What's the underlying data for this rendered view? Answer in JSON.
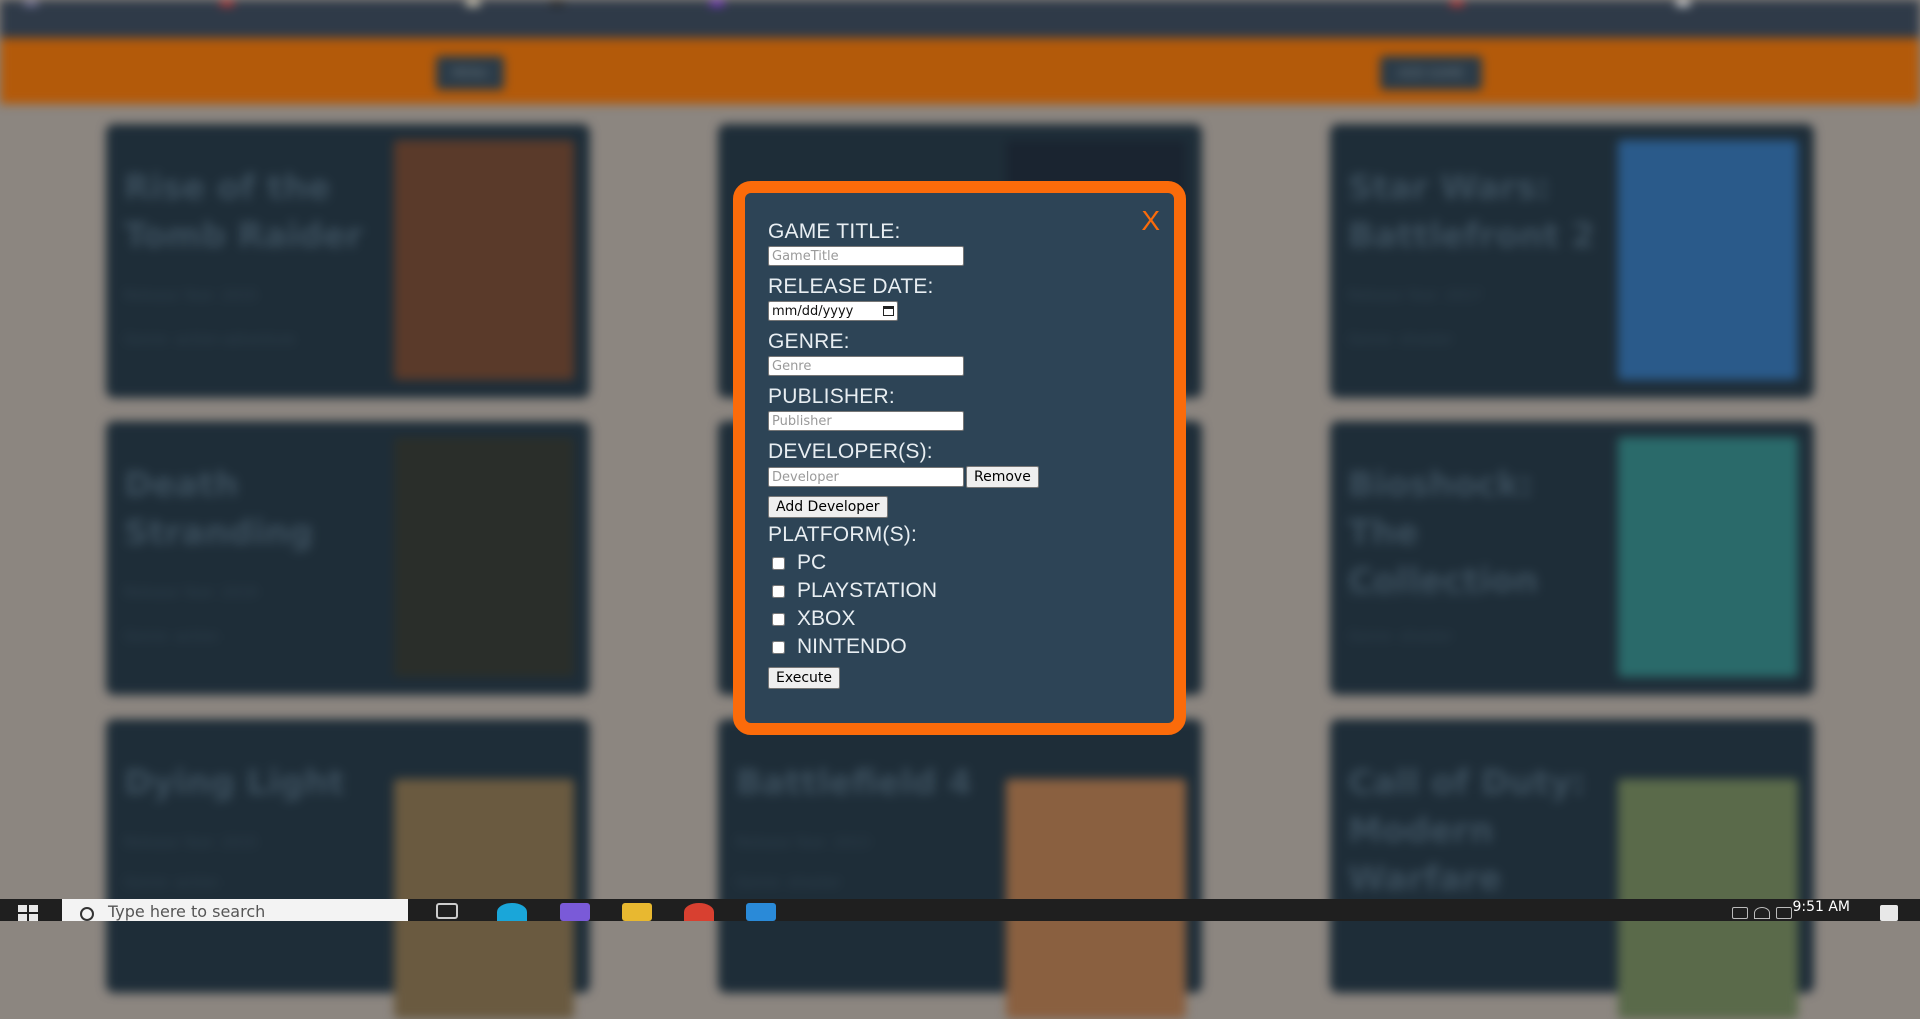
{
  "header": {
    "left_button": "MENU",
    "right_button": "ADD GAME"
  },
  "cards": [
    {
      "title": "Rise of the Tomb Raider",
      "release": "Release Year: 2015",
      "genre": "Genre: action-adventure",
      "cover_color": "#5a3a2a"
    },
    {
      "title": "",
      "release": "",
      "genre": "",
      "cover_color": "#1a2430"
    },
    {
      "title": "Star Wars: Battlefront 2",
      "release": "Release Year: 2017",
      "genre": "Genre: shooter",
      "cover_color": "#2a5a8a"
    },
    {
      "title": "Death Stranding",
      "release": "Release Year: 2019",
      "genre": "Genre: action",
      "cover_color": "#2a2e2a"
    },
    {
      "title": "",
      "release": "",
      "genre": "",
      "cover_color": "#1e2d38"
    },
    {
      "title": "Bioshock: The Collection",
      "release": "Release Year: 2016",
      "genre": "Genre: shooter",
      "cover_color": "#2a6a6a"
    },
    {
      "title": "Dying Light",
      "release": "Release Year: 2015",
      "genre": "Genre: action",
      "cover_color": "#6a5a40"
    },
    {
      "title": "Battlefield 4",
      "release": "Release Year: 2013",
      "genre": "Genre: shooter",
      "cover_color": "#8a6040"
    },
    {
      "title": "Call of Duty: Modern Warfare",
      "release": "Release Year: 2019",
      "genre": "Genre: shooter",
      "cover_color": "#5a6a4a"
    }
  ],
  "modal": {
    "close_label": "X",
    "game_title_label": "GAME TITLE:",
    "game_title_placeholder": "GameTitle",
    "release_date_label": "RELEASE DATE:",
    "release_date_value": "mm/dd/yyyy",
    "genre_label": "GENRE:",
    "genre_placeholder": "Genre",
    "publisher_label": "PUBLISHER:",
    "publisher_placeholder": "Publisher",
    "developers_label": "DEVELOPER(S):",
    "developer_placeholder": "Developer",
    "remove_button": "Remove",
    "add_developer_button": "Add Developer",
    "platforms_label": "PLATFORM(S):",
    "platforms": [
      "PC",
      "PLAYSTATION",
      "XBOX",
      "NINTENDO"
    ],
    "execute_button": "Execute"
  },
  "taskbar": {
    "search_placeholder": "Type here to search",
    "clock": "9:51 AM"
  },
  "colors": {
    "accent": "#fb6b0a",
    "modal_bg": "#2d4456",
    "card_bg": "#1e2d38",
    "header_bg": "#b35a0a"
  }
}
